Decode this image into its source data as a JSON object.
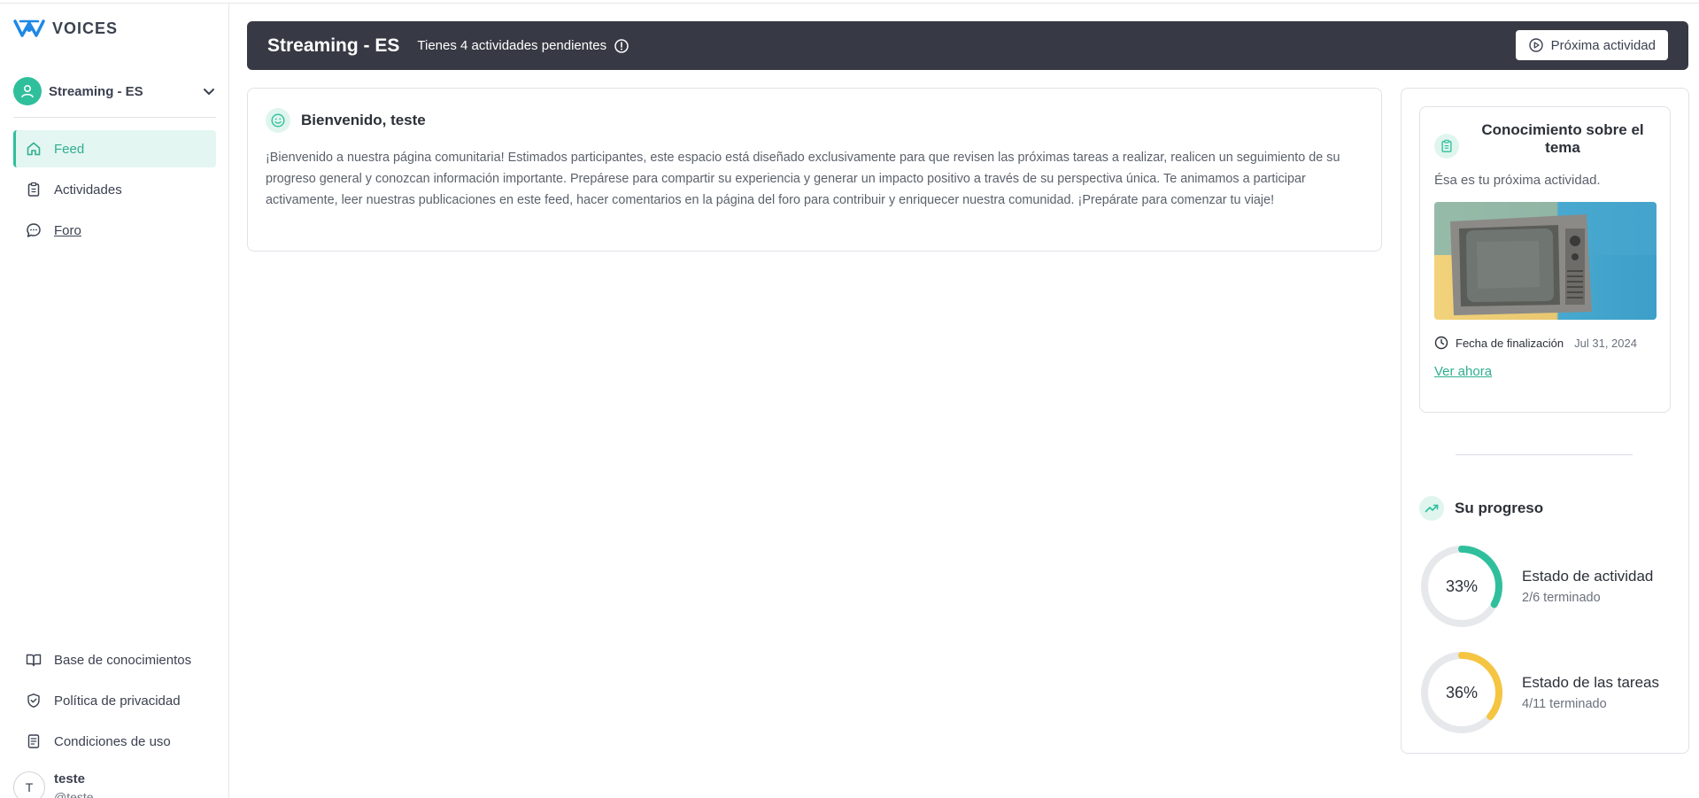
{
  "brand": {
    "name": "VOICES"
  },
  "community": {
    "name": "Streaming - ES"
  },
  "nav": {
    "items": [
      {
        "label": "Feed",
        "icon": "home-icon",
        "active": true
      },
      {
        "label": "Actividades",
        "icon": "clipboard-icon"
      },
      {
        "label": "Foro",
        "icon": "chat-icon"
      }
    ],
    "bottom": [
      {
        "label": "Base de conocimientos",
        "icon": "book-icon"
      },
      {
        "label": "Política de privacidad",
        "icon": "shield-icon"
      },
      {
        "label": "Condiciones de uso",
        "icon": "document-icon"
      }
    ]
  },
  "user": {
    "initial": "T",
    "name": "teste",
    "handle": "@teste"
  },
  "header": {
    "title": "Streaming - ES",
    "pending": "Tienes 4 actividades pendientes",
    "next_button": "Próxima actividad"
  },
  "welcome": {
    "title": "Bienvenido, teste",
    "body": "¡Bienvenido a nuestra página comunitaria! Estimados participantes, este espacio está diseñado exclusivamente para que revisen las próximas tareas a realizar, realicen un seguimiento de su progreso general y conozcan información importante. Prepárese para compartir su experiencia y generar un impacto positivo a través de su perspectiva única. Te animamos a participar activamente, leer nuestras publicaciones en este feed, hacer comentarios en la página del foro para contribuir y enriquecer nuestra comunidad. ¡Prepárate para comenzar tu viaje!"
  },
  "next_activity": {
    "title": "Conocimiento sobre el tema",
    "subtitle": "Ésa es tu próxima actividad.",
    "due_label": "Fecha de finalización",
    "due_value": "Jul 31, 2024",
    "link": "Ver ahora"
  },
  "progress": {
    "title": "Su progreso",
    "items": [
      {
        "pct_label": "33%",
        "fraction": 0.33,
        "label": "Estado de actividad",
        "done": "2/6 terminado",
        "color": "#2fbf9c"
      },
      {
        "pct_label": "36%",
        "fraction": 0.36,
        "label": "Estado de las tareas",
        "done": "4/11 terminado",
        "color": "#f5c542"
      }
    ]
  },
  "colors": {
    "accent": "#2fbf9c",
    "header_bg": "#373a44",
    "ring_track": "#e6e8eb"
  }
}
